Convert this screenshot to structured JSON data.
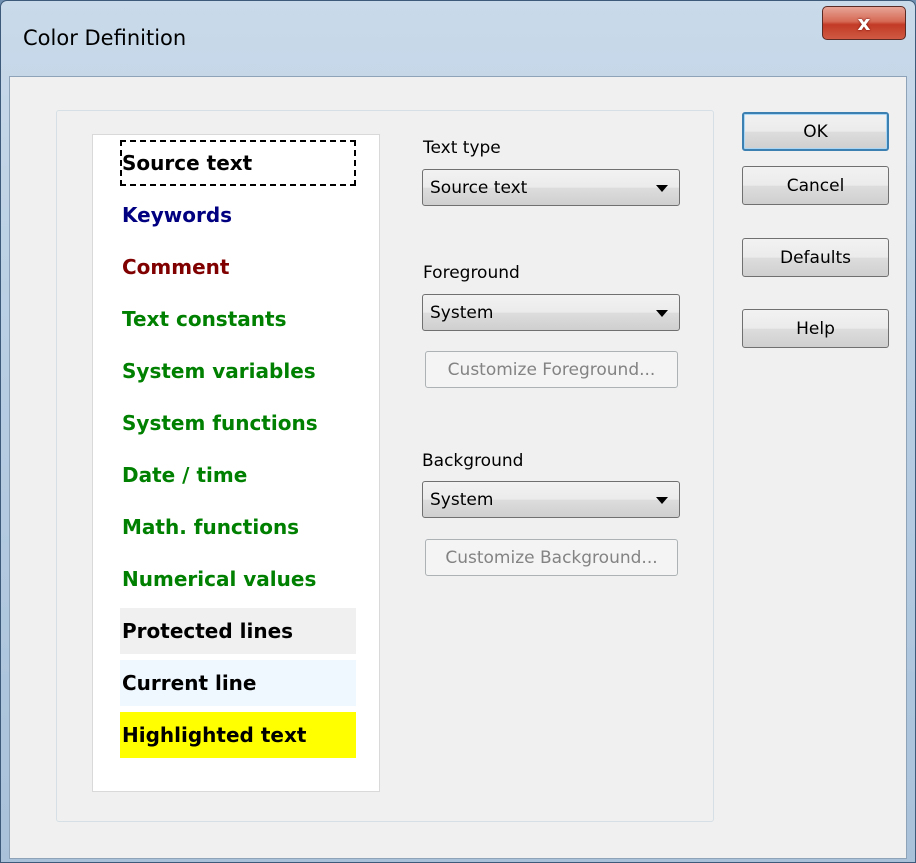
{
  "window": {
    "title": "Color Definition",
    "close_glyph": "x"
  },
  "list": {
    "items": [
      {
        "label": "Source text",
        "color": "#000000",
        "bg": "#ffffff",
        "focused": true
      },
      {
        "label": "Keywords",
        "color": "#000080",
        "bg": "#ffffff"
      },
      {
        "label": "Comment",
        "color": "#800000",
        "bg": "#ffffff"
      },
      {
        "label": "Text constants",
        "color": "#008000",
        "bg": "#ffffff"
      },
      {
        "label": "System variables",
        "color": "#008000",
        "bg": "#ffffff"
      },
      {
        "label": "System functions",
        "color": "#008000",
        "bg": "#ffffff"
      },
      {
        "label": "Date / time",
        "color": "#008000",
        "bg": "#ffffff"
      },
      {
        "label": "Math. functions",
        "color": "#008000",
        "bg": "#ffffff"
      },
      {
        "label": "Numerical values",
        "color": "#008000",
        "bg": "#ffffff"
      },
      {
        "label": "Protected lines",
        "color": "#000000",
        "bg": "#f0f0f0"
      },
      {
        "label": "Current line",
        "color": "#000000",
        "bg": "#f0f8ff"
      },
      {
        "label": "Highlighted text",
        "color": "#000000",
        "bg": "#ffff00"
      }
    ]
  },
  "text_type": {
    "label": "Text type",
    "value": "Source text"
  },
  "foreground": {
    "label": "Foreground",
    "value": "System",
    "customize_label": "Customize Foreground..."
  },
  "background": {
    "label": "Background",
    "value": "System",
    "customize_label": "Customize Background..."
  },
  "buttons": {
    "ok": "OK",
    "cancel": "Cancel",
    "defaults": "Defaults",
    "help": "Help"
  },
  "icons": {
    "close": "close-icon",
    "dropdown": "chevron-down-icon"
  },
  "colors": {
    "accent": "#3c7fb1",
    "close_button": "#c23a25"
  }
}
